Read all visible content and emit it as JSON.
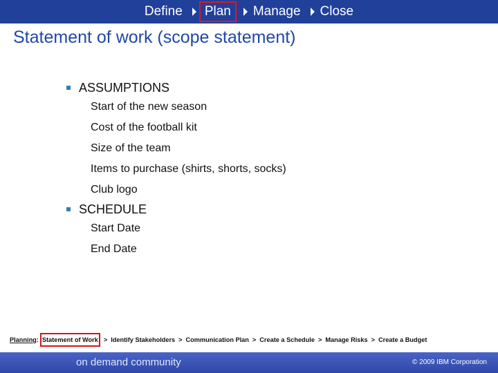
{
  "topnav": {
    "items": [
      {
        "label": "Define"
      },
      {
        "label": "Plan"
      },
      {
        "label": "Manage"
      },
      {
        "label": "Close"
      }
    ]
  },
  "slide": {
    "title": "Statement of work (scope statement)"
  },
  "content": {
    "sections": [
      {
        "heading": "ASSUMPTIONS",
        "items": [
          "Start of the new season",
          "Cost of the football kit",
          "Size of the team",
          "Items to purchase (shirts, shorts, socks)",
          "Club logo"
        ]
      },
      {
        "heading": "SCHEDULE",
        "items": [
          "Start Date",
          "End Date"
        ]
      }
    ]
  },
  "breadcrumb": {
    "lead": "Planning",
    "colon": ":",
    "steps": [
      "Statement of Work",
      "Identify Stakeholders",
      "Communication Plan",
      "Create a Schedule",
      "Manage Risks",
      "Create a Budget"
    ],
    "separator": ">"
  },
  "footer": {
    "logo": "on demand community",
    "copyright": "© 2009 IBM Corporation"
  },
  "colors": {
    "topbar": "#20409a",
    "title": "#2048a8",
    "highlight": "#e8141b",
    "bullet": "#2f7fb8",
    "footer": "#3a55b8"
  }
}
